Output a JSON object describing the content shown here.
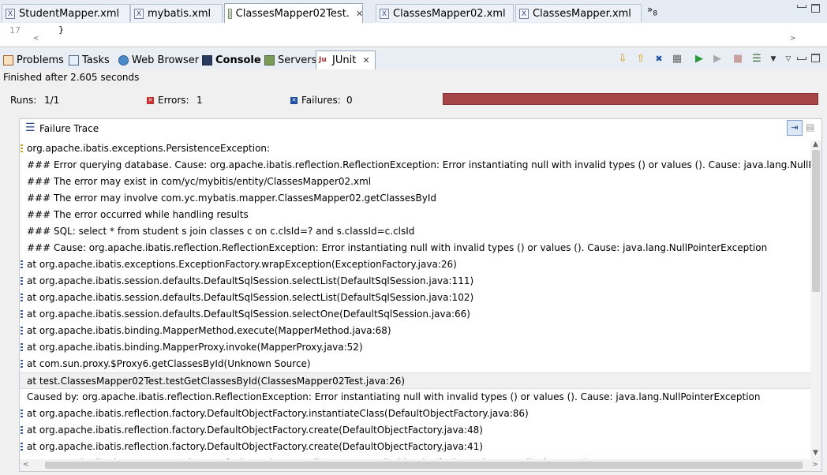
{
  "editor_tabs": [
    {
      "label": "StudentMapper.xml",
      "icon": "xml-file-icon"
    },
    {
      "label": "mybatis.xml",
      "icon": "xml-file-icon"
    },
    {
      "label": "ClassesMapper02Test.",
      "icon": "java-file-icon",
      "active": true
    },
    {
      "label": "ClassesMapper02.xml",
      "icon": "xml-file-icon"
    },
    {
      "label": "ClassesMapper.xml",
      "icon": "xml-file-icon"
    }
  ],
  "editor": {
    "overflow_count": "8",
    "line_number": "17",
    "line_text": "}"
  },
  "view_tabs": [
    {
      "label": "Problems",
      "icon": "problems-icon"
    },
    {
      "label": "Tasks",
      "icon": "tasks-icon"
    },
    {
      "label": "Web Browser",
      "icon": "globe-icon"
    },
    {
      "label": "Console",
      "icon": "console-icon"
    },
    {
      "label": "Servers",
      "icon": "servers-icon"
    },
    {
      "label": "JUnit",
      "icon": "junit-icon",
      "active": true
    }
  ],
  "junit": {
    "status": "Finished after 2.605 seconds",
    "runs_label": "Runs:",
    "runs_value": "1/1",
    "errors_label": "Errors:",
    "errors_value": "1",
    "failures_label": "Failures:",
    "failures_value": "0",
    "progress_color": "#a54545",
    "progress_fraction": 1.0,
    "failure_trace_title": "Failure Trace"
  },
  "trace_lines": [
    {
      "text": "org.apache.ibatis.exceptions.PersistenceException:",
      "icon": "warn"
    },
    {
      "text": "### Error querying database.  Cause: org.apache.ibatis.reflection.ReflectionException: Error instantiating null with invalid types () or values (). Cause: java.lang.NullPointerE:",
      "icon": "none"
    },
    {
      "text": "### The error may exist in com/yc/mybitis/entity/ClassesMapper02.xml",
      "icon": "none"
    },
    {
      "text": "### The error may involve com.yc.mybatis.mapper.ClassesMapper02.getClassesById",
      "icon": "none"
    },
    {
      "text": "### The error occurred while handling results",
      "icon": "none"
    },
    {
      "text": "### SQL: select * from student s join classes c on c.clsId=? and s.classId=c.clsId",
      "icon": "none"
    },
    {
      "text": "### Cause: org.apache.ibatis.reflection.ReflectionException: Error instantiating null with invalid types () or values (). Cause: java.lang.NullPointerException",
      "icon": "none"
    },
    {
      "text": " at org.apache.ibatis.exceptions.ExceptionFactory.wrapException(ExceptionFactory.java:26)",
      "icon": "stack"
    },
    {
      "text": " at org.apache.ibatis.session.defaults.DefaultSqlSession.selectList(DefaultSqlSession.java:111)",
      "icon": "stack"
    },
    {
      "text": " at org.apache.ibatis.session.defaults.DefaultSqlSession.selectList(DefaultSqlSession.java:102)",
      "icon": "stack"
    },
    {
      "text": " at org.apache.ibatis.session.defaults.DefaultSqlSession.selectOne(DefaultSqlSession.java:66)",
      "icon": "stack"
    },
    {
      "text": " at org.apache.ibatis.binding.MapperMethod.execute(MapperMethod.java:68)",
      "icon": "stack"
    },
    {
      "text": " at org.apache.ibatis.binding.MapperProxy.invoke(MapperProxy.java:52)",
      "icon": "stack"
    },
    {
      "text": " at com.sun.proxy.$Proxy6.getClassesById(Unknown Source)",
      "icon": "stack"
    },
    {
      "text": " at test.ClassesMapper02Test.testGetClassesById(ClassesMapper02Test.java:26)",
      "icon": "none",
      "selected": true
    },
    {
      "text": "Caused by: org.apache.ibatis.reflection.ReflectionException: Error instantiating null with invalid types () or values (). Cause: java.lang.NullPointerException",
      "icon": "none"
    },
    {
      "text": " at org.apache.ibatis.reflection.factory.DefaultObjectFactory.instantiateClass(DefaultObjectFactory.java:86)",
      "icon": "stack"
    },
    {
      "text": " at org.apache.ibatis.reflection.factory.DefaultObjectFactory.create(DefaultObjectFactory.java:48)",
      "icon": "stack"
    },
    {
      "text": " at org.apache.ibatis.reflection.factory.DefaultObjectFactory.create(DefaultObjectFactory.java:41)",
      "icon": "stack"
    },
    {
      "text": " at org.apache.ibatis.executor.resultset.DefaultResultSetHandler.createResultObject(DefaultResultSetHandler.java:539)",
      "icon": "stack"
    }
  ]
}
